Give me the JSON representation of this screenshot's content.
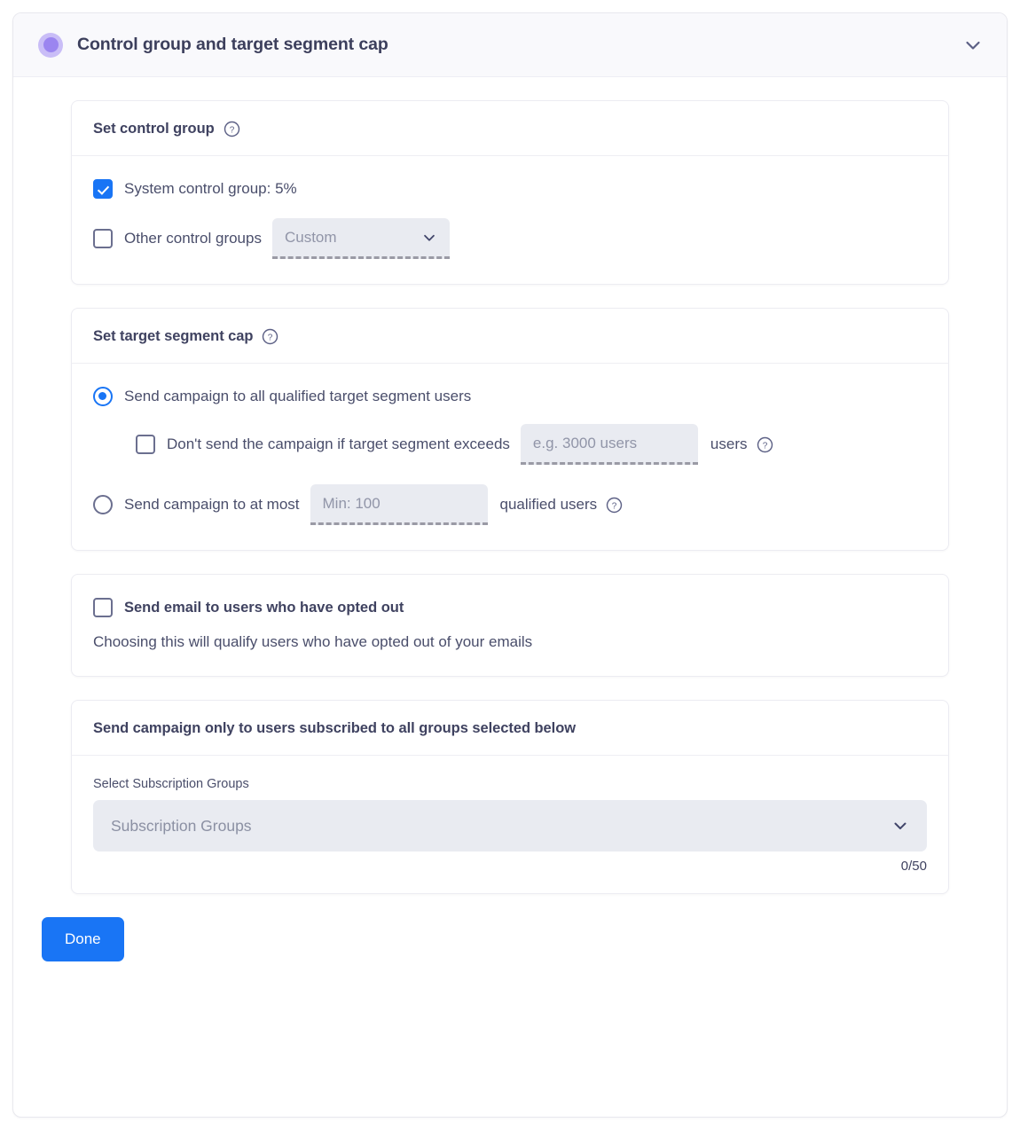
{
  "panel": {
    "title": "Control group and target segment cap",
    "collapse_icon": "chevron-down-icon",
    "status_dot_color": "#9b85f0"
  },
  "colors": {
    "accent_blue": "#1975f5",
    "dot_purple": "#9b85f0",
    "dot_ring_purple": "#c9bdf7",
    "text_slate": "#4a4e6b",
    "field_grey": "#e9ebf1"
  },
  "control_group": {
    "title": "Set control group",
    "help_icon": "help-circle-icon",
    "system_control": {
      "label": "System control group: 5%",
      "checked": true
    },
    "other_control": {
      "label": "Other control groups",
      "checked": false,
      "dropdown_value": "Custom",
      "dropdown_icon": "chevron-down-icon"
    }
  },
  "target_cap": {
    "title": "Set target segment cap",
    "help_icon": "help-circle-icon",
    "option_all": {
      "label": "Send campaign to all qualified target segment users",
      "selected": true
    },
    "exceed_check": {
      "label": "Don't send the campaign if target segment exceeds",
      "checked": false,
      "input_placeholder": "e.g. 3000 users",
      "input_value": "",
      "suffix": "users",
      "help_icon": "help-circle-icon"
    },
    "option_at_most": {
      "label": "Send campaign to at most",
      "selected": false,
      "input_placeholder": "Min: 100",
      "input_value": "",
      "suffix": "qualified users",
      "help_icon": "help-circle-icon"
    }
  },
  "opted_out": {
    "label": "Send email to users who have opted out",
    "checked": false,
    "description": "Choosing this will qualify users who have opted out of your emails"
  },
  "subscription": {
    "title": "Send campaign only to users subscribed to all groups selected below",
    "field_label": "Select Subscription Groups",
    "select_placeholder": "Subscription Groups",
    "select_icon": "chevron-down-icon",
    "counter": "0/50"
  },
  "footer": {
    "done_label": "Done"
  }
}
